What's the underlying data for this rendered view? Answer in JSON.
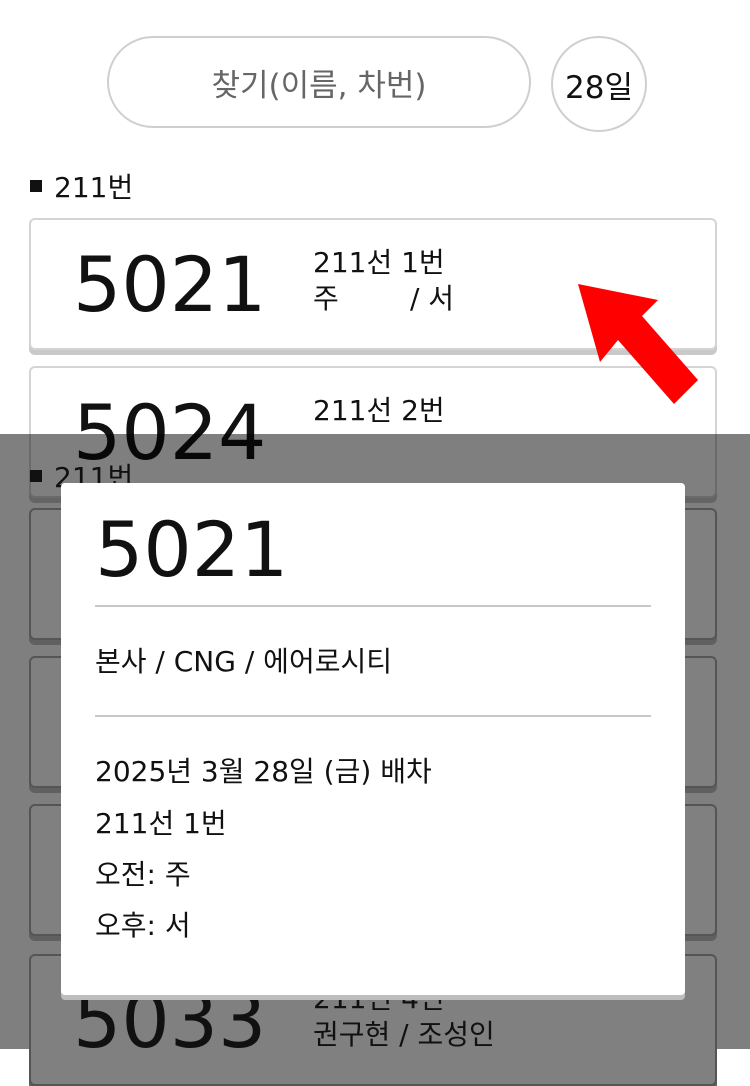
{
  "search": {
    "placeholder": "찾기(이름, 차번)"
  },
  "date_button": {
    "label": "28일"
  },
  "section": {
    "title": "211번"
  },
  "cards": [
    {
      "number": "5021",
      "route": "211선 1번",
      "shift": "주        / 서"
    },
    {
      "number": "5024",
      "route": "211선 2번",
      "shift": ""
    }
  ],
  "background": {
    "section_title": "211번",
    "last_card": {
      "number": "5033",
      "route": "211선 4번",
      "shift": "권구현 / 조성인"
    }
  },
  "modal": {
    "number": "5021",
    "company_line": "본사 / CNG / 에어로시티",
    "date_line": "2025년 3월 28일 (금) 배차",
    "route_line": "211선 1번",
    "morning": "오전: 주",
    "afternoon": "오후: 서"
  },
  "colors": {
    "arrow": "#ff0000",
    "overlay": "rgba(0,0,0,0.5)"
  }
}
